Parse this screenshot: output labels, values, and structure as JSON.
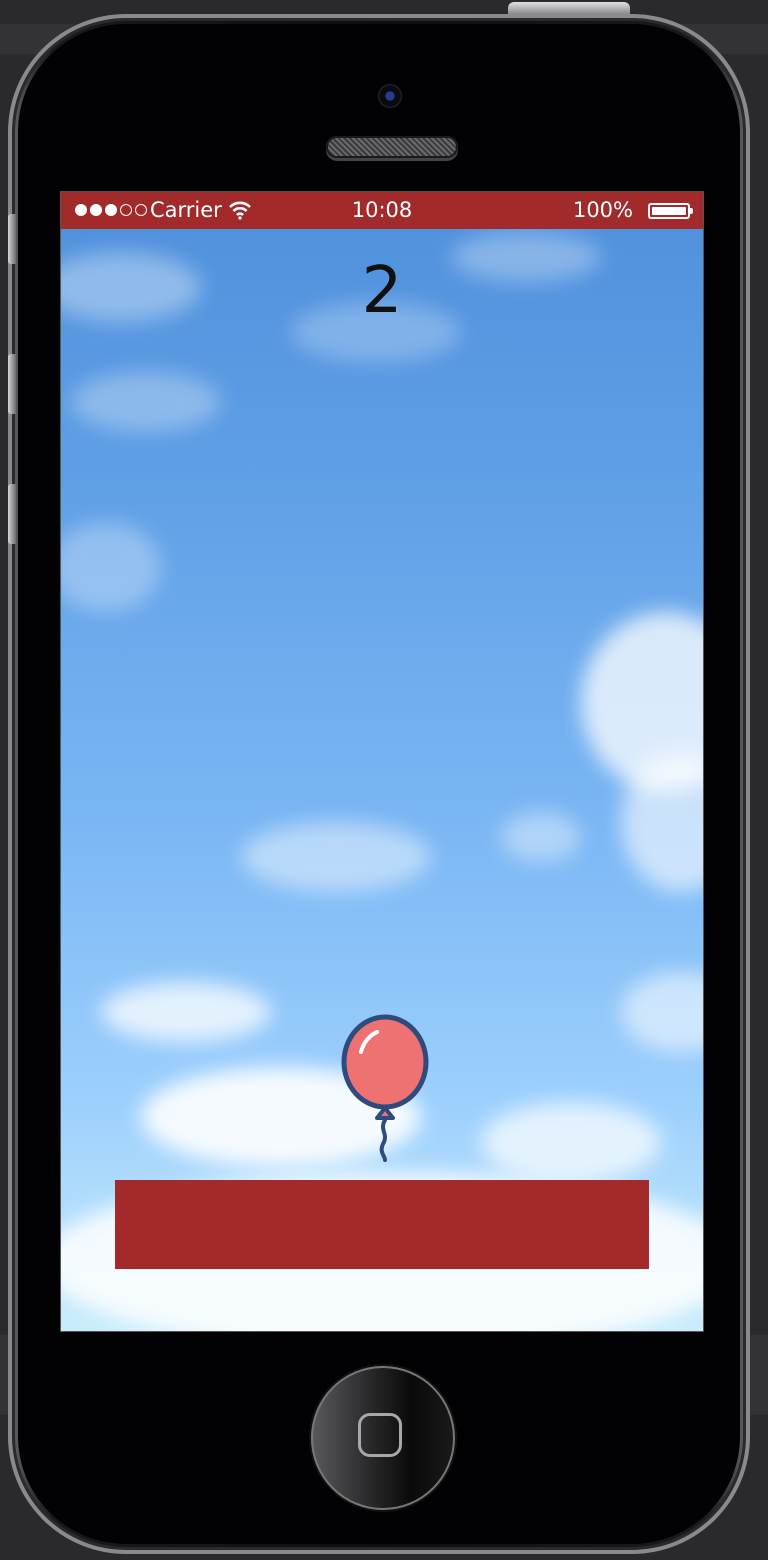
{
  "status_bar": {
    "signal_bars": 3,
    "signal_total": 5,
    "carrier": "Carrier",
    "time": "10:08",
    "battery": "100%",
    "battery_level": 1.0,
    "background_color": "#a32a2a"
  },
  "game": {
    "score": "2",
    "player_icon": "balloon-icon",
    "balloon_color": "#ef7273",
    "balloon_outline_color": "#2f4a7c",
    "platform_color": "#a32a2a"
  },
  "device": {
    "home_button_icon": "home-square-icon"
  }
}
